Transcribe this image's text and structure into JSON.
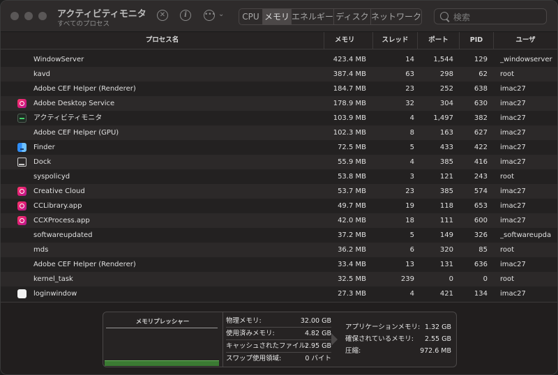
{
  "window": {
    "title": "アクティビティモニタ",
    "subtitle": "すべてのプロセス"
  },
  "toolbar": {
    "icons": [
      "stop-icon",
      "info-icon",
      "ellipsis-icon",
      "chevron-down-icon"
    ],
    "tabs": [
      {
        "label": "CPU",
        "active": false
      },
      {
        "label": "メモリ",
        "active": true
      },
      {
        "label": "エネルギー",
        "active": false
      },
      {
        "label": "ディスク",
        "active": false
      },
      {
        "label": "ネットワーク",
        "active": false
      }
    ],
    "search_placeholder": "検索"
  },
  "table": {
    "columns": {
      "name": "プロセス名",
      "memory": "メモリ",
      "threads": "スレッド",
      "ports": "ポート",
      "pid": "PID",
      "user": "ユーザ"
    },
    "rows": [
      {
        "icon": "",
        "name": "WindowServer",
        "memory": "423.4 MB",
        "threads": "14",
        "ports": "1,544",
        "pid": "129",
        "user": "_windowserver"
      },
      {
        "icon": "",
        "name": "kavd",
        "memory": "387.4 MB",
        "threads": "63",
        "ports": "298",
        "pid": "62",
        "user": "root"
      },
      {
        "icon": "",
        "name": "Adobe CEF Helper (Renderer)",
        "memory": "184.7 MB",
        "threads": "23",
        "ports": "252",
        "pid": "638",
        "user": "imac27"
      },
      {
        "icon": "creative-cloud-icon",
        "name": "Adobe Desktop Service",
        "memory": "178.9 MB",
        "threads": "32",
        "ports": "304",
        "pid": "630",
        "user": "imac27"
      },
      {
        "icon": "activity-monitor-icon",
        "name": "アクティビティモニタ",
        "memory": "103.9 MB",
        "threads": "4",
        "ports": "1,497",
        "pid": "382",
        "user": "imac27"
      },
      {
        "icon": "",
        "name": "Adobe CEF Helper (GPU)",
        "memory": "102.3 MB",
        "threads": "8",
        "ports": "163",
        "pid": "627",
        "user": "imac27"
      },
      {
        "icon": "finder-icon",
        "name": "Finder",
        "memory": "72.5 MB",
        "threads": "5",
        "ports": "433",
        "pid": "422",
        "user": "imac27"
      },
      {
        "icon": "dock-icon",
        "name": "Dock",
        "memory": "55.9 MB",
        "threads": "4",
        "ports": "385",
        "pid": "416",
        "user": "imac27"
      },
      {
        "icon": "",
        "name": "syspolicyd",
        "memory": "53.8 MB",
        "threads": "3",
        "ports": "121",
        "pid": "243",
        "user": "root"
      },
      {
        "icon": "creative-cloud-icon",
        "name": "Creative Cloud",
        "memory": "53.7 MB",
        "threads": "23",
        "ports": "385",
        "pid": "574",
        "user": "imac27"
      },
      {
        "icon": "creative-cloud-icon",
        "name": "CCLibrary.app",
        "memory": "49.7 MB",
        "threads": "19",
        "ports": "118",
        "pid": "653",
        "user": "imac27"
      },
      {
        "icon": "creative-cloud-icon",
        "name": "CCXProcess.app",
        "memory": "42.0 MB",
        "threads": "18",
        "ports": "111",
        "pid": "600",
        "user": "imac27"
      },
      {
        "icon": "",
        "name": "softwareupdated",
        "memory": "37.2 MB",
        "threads": "5",
        "ports": "149",
        "pid": "326",
        "user": "_softwareupda"
      },
      {
        "icon": "",
        "name": "mds",
        "memory": "36.2 MB",
        "threads": "6",
        "ports": "320",
        "pid": "85",
        "user": "root"
      },
      {
        "icon": "",
        "name": "Adobe CEF Helper (Renderer)",
        "memory": "33.4 MB",
        "threads": "13",
        "ports": "131",
        "pid": "636",
        "user": "imac27"
      },
      {
        "icon": "",
        "name": "kernel_task",
        "memory": "32.5 MB",
        "threads": "239",
        "ports": "0",
        "pid": "0",
        "user": "root"
      },
      {
        "icon": "login-window-icon",
        "name": "loginwindow",
        "memory": "27.3 MB",
        "threads": "4",
        "ports": "421",
        "pid": "134",
        "user": "imac27"
      }
    ]
  },
  "memory_panel": {
    "pressure_title": "メモリプレッシャー",
    "pressure_level": 0.1,
    "pressure_color": "#3b7a33",
    "stats": [
      {
        "label": "物理メモリ:",
        "value": "32.00 GB"
      },
      {
        "label": "使用済みメモリ:",
        "value": "4.82 GB"
      },
      {
        "label": "キャッシュされたファイル:",
        "value": "2.95 GB"
      },
      {
        "label": "スワップ使用領域:",
        "value": "0 バイト"
      }
    ],
    "breakdown": [
      {
        "label": "アプリケーションメモリ:",
        "value": "1.32 GB"
      },
      {
        "label": "確保されているメモリ:",
        "value": "2.55 GB"
      },
      {
        "label": "圧縮:",
        "value": "972.6 MB"
      }
    ]
  }
}
